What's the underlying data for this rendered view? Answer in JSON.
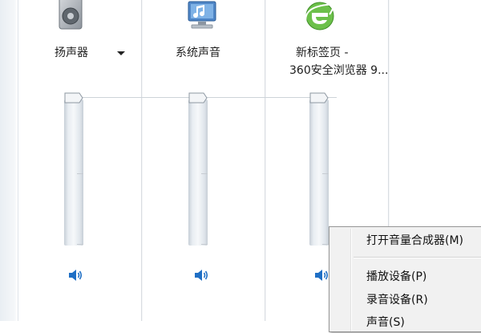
{
  "channels": [
    {
      "id": "speakers",
      "label_lines": [
        "扬声器"
      ],
      "icon": "speaker-device-icon",
      "has_dropdown": true,
      "level": 1.0
    },
    {
      "id": "system-sounds",
      "label_lines": [
        "系统声音"
      ],
      "icon": "system-sounds-icon",
      "has_dropdown": false,
      "level": 1.0
    },
    {
      "id": "browser",
      "label_lines": [
        "新标签页 -",
        "360安全浏览器 9..."
      ],
      "icon": "ie-browser-icon",
      "has_dropdown": false,
      "level": 1.0
    }
  ],
  "context_menu": {
    "items": [
      {
        "label": "打开音量合成器(M)",
        "default": true
      },
      {
        "label": "播放设备(P)"
      },
      {
        "label": "录音设备(R)"
      },
      {
        "label": "声音(S)"
      }
    ]
  },
  "colors": {
    "track": "#dfe5eb",
    "speaker_blue": "#1f6fc5",
    "menu_bg": "#f1f1f1"
  }
}
